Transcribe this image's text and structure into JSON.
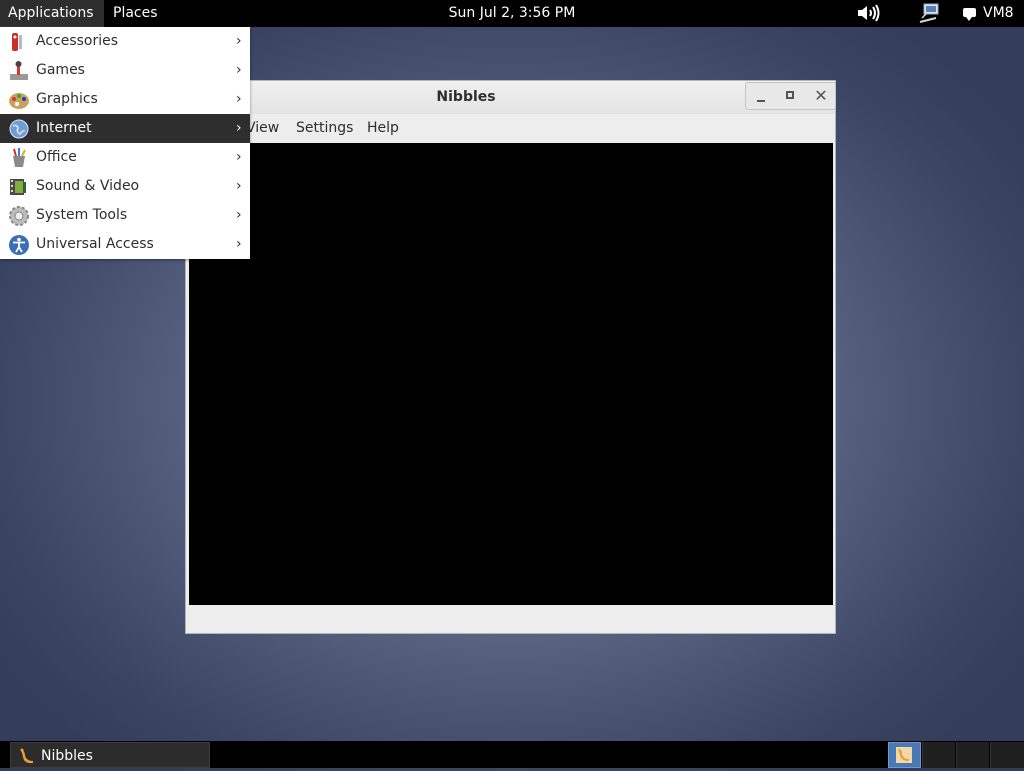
{
  "top_panel": {
    "applications": "Applications",
    "places": "Places",
    "clock": "Sun Jul  2,  3:56 PM",
    "user": "VM8",
    "icons": [
      "volume-icon",
      "network-icon",
      "chat-bubble-icon"
    ]
  },
  "window": {
    "title": "Nibbles",
    "menu": {
      "view": "View",
      "settings": "Settings",
      "help": "Help"
    },
    "controls": [
      "minimize-icon",
      "maximize-icon",
      "close-icon"
    ],
    "close_glyph": "✕"
  },
  "apps_menu": {
    "items": [
      {
        "label": "Accessories",
        "icon": "accessories-icon"
      },
      {
        "label": "Games",
        "icon": "games-icon"
      },
      {
        "label": "Graphics",
        "icon": "graphics-icon"
      },
      {
        "label": "Internet",
        "icon": "internet-icon",
        "active": true
      },
      {
        "label": "Office",
        "icon": "office-icon"
      },
      {
        "label": "Sound & Video",
        "icon": "sound-video-icon"
      },
      {
        "label": "System Tools",
        "icon": "system-tools-icon"
      },
      {
        "label": "Universal Access",
        "icon": "universal-access-icon"
      }
    ],
    "arrow": "›"
  },
  "bottom_panel": {
    "task": "Nibbles",
    "workspaces": 4,
    "active_workspace": 1
  },
  "colors": {
    "panel": "#000000",
    "menu_highlight": "#2e2e2e",
    "workspace_active": "#4a78b5"
  }
}
